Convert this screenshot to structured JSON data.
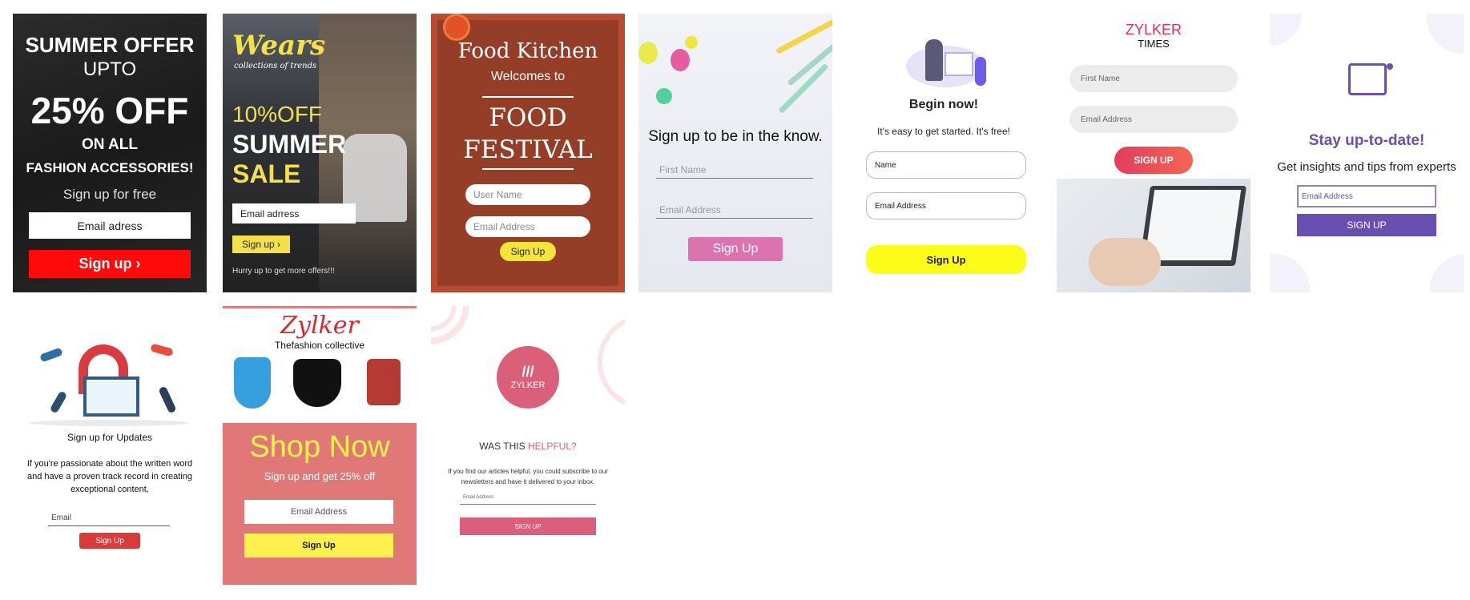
{
  "card1": {
    "line1": "SUMMER OFFER",
    "line2": "UPTO",
    "line3": "25% OFF",
    "line4": "ON ALL",
    "line5": "FASHION ACCESSORIES!",
    "line6": "Sign up for free",
    "email_placeholder": "Email adress",
    "button": "Sign up ›",
    "accent": "#ff0a0a"
  },
  "card2": {
    "brand": "Wears",
    "tagline": "collections of trends",
    "promo1": "10%OFF",
    "promo2": "SUMMER",
    "promo3": "SALE",
    "email_placeholder": "Email adrress",
    "button": "Sign up ›",
    "note": "Hurry up to get more offers!!!",
    "accent": "#f3e04a"
  },
  "card3": {
    "title": "Food Kitchen",
    "welcome": "Welcomes to",
    "event1": "FOOD",
    "event2": "FESTIVAL",
    "name_placeholder": "User Name",
    "email_placeholder": "Email Address",
    "button": "Sign Up",
    "accent": "#953e27"
  },
  "card4": {
    "heading": "Sign up to be in the know.",
    "first_name_placeholder": "First Name",
    "email_placeholder": "Email Address",
    "button": "Sign Up",
    "accent": "#db74ae"
  },
  "card5": {
    "heading": "Begin now!",
    "subheading": "It's easy to get started. It's free!",
    "name_placeholder": "Name",
    "email_placeholder": "Email Address",
    "button": "Sign Up",
    "accent": "#fcfc19"
  },
  "card6": {
    "brand1": "ZYLKER",
    "brand2": "TIMES",
    "first_name_placeholder": "First Name",
    "email_placeholder": "Email Address",
    "button": "SIGN UP",
    "accent": "#e5305c"
  },
  "card7": {
    "heading": "Stay up-to-date!",
    "subheading": "Get insights and tips from experts",
    "email_placeholder": "Email Address",
    "button": "SIGN UP",
    "accent": "#6a4fb3"
  },
  "card8": {
    "heading": "Sign up for Updates",
    "body": "If you're passionate about the written word and have a proven track record in creating exceptional content,",
    "email_placeholder": "Email",
    "button": "Sign Up",
    "accent": "#d93b3b"
  },
  "card9": {
    "brand": "Zylker",
    "subtitle": "Thefashion collective",
    "heading": "Shop Now",
    "subheading": "Sign up and get 25% off",
    "email_placeholder": "Email Address",
    "button": "Sign Up",
    "accent": "#e07878"
  },
  "card10": {
    "logo_icon": "///",
    "logo_text": "ZYLKER",
    "heading_part1": "WAS THIS",
    "heading_part2": "HELPFUL?",
    "body": "If you find our articles helpful, you could subscribe to our newsletters and have it delivered to your inbox.",
    "email_placeholder": "Email Address",
    "button": "SIGN UP",
    "accent": "#d95f7a"
  }
}
